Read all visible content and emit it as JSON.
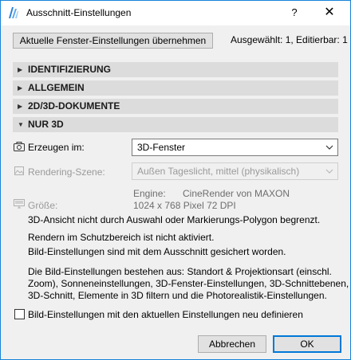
{
  "window": {
    "title": "Ausschnitt-Einstellungen",
    "help_label": "?",
    "close_label": "✕",
    "accent_color": "#1883d7"
  },
  "toolbar": {
    "apply_button_label": "Aktuelle Fenster-Einstellungen übernehmen",
    "selection_info": "Ausgewählt: 1, Editierbar: 1"
  },
  "sections": [
    {
      "label": "IDENTIFIZIERUNG",
      "expanded": false
    },
    {
      "label": "ALLGEMEIN",
      "expanded": false
    },
    {
      "label": "2D/3D-DOKUMENTE",
      "expanded": false
    },
    {
      "label": "NUR 3D",
      "expanded": true
    }
  ],
  "nur3d": {
    "create_in_label": "Erzeugen im:",
    "create_in_value": "3D-Fenster",
    "rendering_scene_label": "Rendering-Szene:",
    "rendering_scene_value": "Außen Tageslicht, mittel (physikalisch)",
    "engine_label": "Engine:",
    "engine_value": "CineRender von MAXON",
    "size_label": "Größe:",
    "size_value": "1024 x 768 Pixel 72 DPI",
    "info_1": "3D-Ansicht nicht durch Auswahl oder Markierungs-Polygon begrenzt.",
    "info_2": "Rendern im Schutzbereich ist nicht aktiviert.",
    "info_3": "Bild-Einstellungen sind mit dem Ausschnitt gesichert worden.",
    "info_4_line1": "Die Bild-Einstellungen bestehen aus: Standort & Projektionsart (einschl.",
    "info_4_line2": "Zoom), Sonneneinstellungen, 3D-Fenster-Einstellungen, 3D-Schnittebenen,",
    "info_4_line3": "3D-Schnitt, Elemente in 3D filtern und die Photorealistik-Einstellungen."
  },
  "redefine_checkbox": {
    "label": "Bild-Einstellungen mit den aktuellen Einstellungen neu definieren",
    "checked": false
  },
  "footer": {
    "cancel_label": "Abbrechen",
    "ok_label": "OK"
  }
}
